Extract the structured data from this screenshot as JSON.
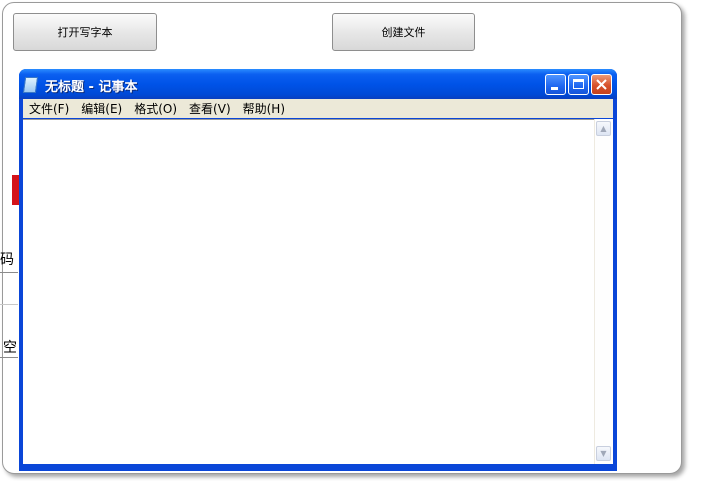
{
  "buttons": {
    "open_text": "打开写字本",
    "create_file": "创建文件"
  },
  "background": {
    "char_1": "码",
    "char_2": "空"
  },
  "notepad": {
    "title": "无标题 - 记事本",
    "menu": [
      "文件(F)",
      "编辑(E)",
      "格式(O)",
      "查看(V)",
      "帮助(H)"
    ],
    "content": ""
  },
  "icons": {
    "app": "notepad-icon",
    "minimize": "minimize-icon",
    "maximize": "maximize-icon",
    "close": "close-icon",
    "scroll_up": "chevron-up-icon",
    "scroll_down": "chevron-down-icon"
  },
  "colors": {
    "title_bar": "#0053e8",
    "close_button": "#d7512b",
    "menu_bar": "#ece9d8",
    "accent_red": "#d4141a"
  }
}
